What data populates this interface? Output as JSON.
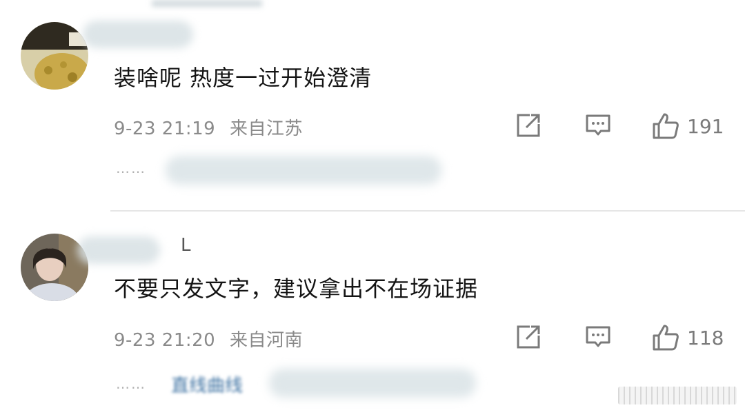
{
  "comments": [
    {
      "username": "",
      "text": "装啥呢 热度一过开始澄清",
      "time": "9-23 21:19",
      "location": "来自江苏",
      "likes": "191",
      "replies_preview": "",
      "dots": "……"
    },
    {
      "username": "L",
      "text": "不要只发文字，建议拿出不在场证据",
      "time": "9-23 21:20",
      "location": "来自河南",
      "likes": "118",
      "replies_preview": "直线曲线",
      "dots": "……"
    }
  ],
  "icons": {
    "share": "share-icon",
    "reply": "comment-icon",
    "like": "thumbs-up-icon"
  },
  "colors": {
    "text": "#141414",
    "meta": "#8a8a8a",
    "link": "#3a6fa0",
    "divider": "#e6e6e6"
  }
}
